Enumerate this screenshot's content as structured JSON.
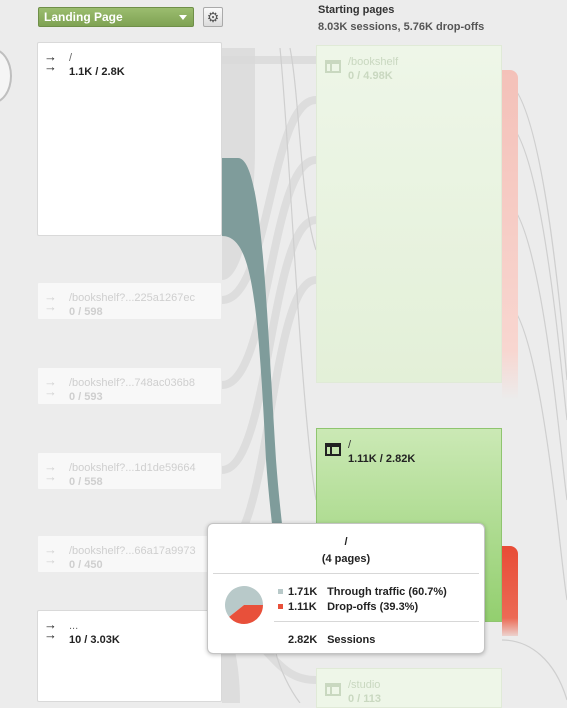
{
  "controls": {
    "dimension": "Landing Page",
    "dimension_caret": "chevron-down-icon",
    "settings_icon": "gear-icon",
    "accent": "#8ab05d"
  },
  "column": {
    "title": "Starting pages",
    "subtitle": "8.03K sessions, 5.76K drop-offs"
  },
  "landing_nodes": [
    {
      "title": "/",
      "stats": "1.1K / 2.8K",
      "faded": false
    },
    {
      "title": "/bookshelf?...225a1267ec",
      "stats": "0 / 598",
      "faded": true
    },
    {
      "title": "/bookshelf?...748ac036b8",
      "stats": "0 / 593",
      "faded": true
    },
    {
      "title": "/bookshelf?...1d1de59664",
      "stats": "0 / 558",
      "faded": true
    },
    {
      "title": "/bookshelf?...66a17a9973",
      "stats": "0 / 450",
      "faded": true
    },
    {
      "title": "...",
      "stats": "10 / 3.03K",
      "faded": false
    }
  ],
  "landing_icon": "entrance-arrow-icon",
  "starting_pages": [
    {
      "title": "/bookshelf",
      "stats": "0 / 4.98K",
      "faded": true
    },
    {
      "title": "/",
      "stats": "1.11K / 2.82K",
      "faded": false
    },
    {
      "title": "/studio",
      "stats": "0 / 113",
      "faded": true
    }
  ],
  "page_icon": "page-layout-icon",
  "tooltip": {
    "title": "/",
    "subtitle": "(4 pages)",
    "through": {
      "value": "1.71K",
      "label": "Through traffic (60.7%)",
      "fraction": 0.607,
      "color": "#b8c9c9"
    },
    "dropoff": {
      "value": "1.11K",
      "label": "Drop-offs (39.3%)",
      "fraction": 0.393,
      "color": "#e8503a"
    },
    "total": {
      "value": "2.82K",
      "label": "Sessions"
    }
  },
  "colors": {
    "highlight_flow": "#7f9c9b",
    "page_green": "#9ed57f",
    "page_green_faded": "#e6f2dc",
    "dropoff_red": "#ea5a43",
    "dropoff_red_faded": "#f5c7c0"
  }
}
